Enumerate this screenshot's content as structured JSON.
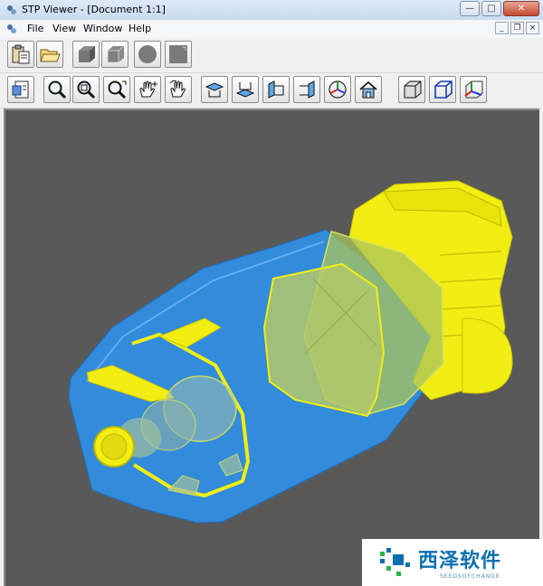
{
  "window": {
    "title": "STP Viewer - [Document 1:1]",
    "controls": {
      "minimize": "—",
      "maximize": "□",
      "close": "✕"
    }
  },
  "menubar": {
    "items": [
      {
        "label": "File"
      },
      {
        "label": "View"
      },
      {
        "label": "Window"
      },
      {
        "label": "Help"
      }
    ],
    "mdi_controls": {
      "minimize": "_",
      "restore": "❐",
      "close": "×"
    }
  },
  "toolbar_top": {
    "buttons": [
      {
        "name": "paste-button",
        "icon": "clipboard-icon"
      },
      {
        "name": "open-button",
        "icon": "folder-open-icon"
      },
      {
        "name": "shaded-box-button",
        "icon": "gray-box-icon"
      },
      {
        "name": "wire-box-button",
        "icon": "gray-box-edges-icon"
      },
      {
        "name": "sphere-button",
        "icon": "gray-sphere-icon"
      },
      {
        "name": "plane-button",
        "icon": "gray-plane-icon"
      }
    ]
  },
  "toolbar_view": {
    "buttons": [
      {
        "name": "select-button",
        "icon": "select-doc-icon"
      },
      {
        "name": "zoom-button",
        "icon": "magnifier-icon"
      },
      {
        "name": "zoom-window-button",
        "icon": "magnifier-window-icon"
      },
      {
        "name": "zoom-fit-button",
        "icon": "magnifier-fit-icon"
      },
      {
        "name": "pan-button",
        "icon": "hand-move-icon"
      },
      {
        "name": "rotate-button",
        "icon": "hand-rotate-icon"
      },
      {
        "name": "view-top-button",
        "icon": "view-top-icon"
      },
      {
        "name": "view-bottom-button",
        "icon": "view-bottom-icon"
      },
      {
        "name": "view-left-button",
        "icon": "view-left-icon"
      },
      {
        "name": "view-right-button",
        "icon": "view-right-icon"
      },
      {
        "name": "view-axo-button",
        "icon": "axis-globe-icon"
      },
      {
        "name": "view-home-button",
        "icon": "home-icon"
      },
      {
        "name": "shaded-mode-button",
        "icon": "cube-shaded-icon"
      },
      {
        "name": "wireframe-mode-button",
        "icon": "cube-wire-icon"
      },
      {
        "name": "axes-toggle-button",
        "icon": "cube-axes-icon"
      }
    ]
  },
  "viewport": {
    "background_color": "#595959",
    "model_colors": {
      "body": "#2f8fe6",
      "cap": "#f2ee14",
      "inner": "#a9c45c"
    }
  },
  "watermark": {
    "title": "西泽软件",
    "subtitle": "SEEDSOFCHANGE",
    "color": "#0b6fb0"
  }
}
